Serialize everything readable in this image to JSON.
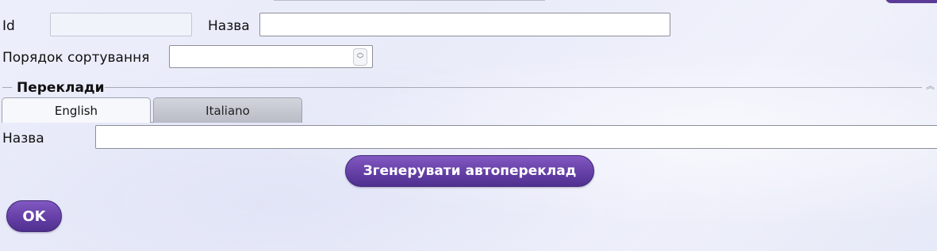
{
  "form": {
    "id_label": "Id",
    "id_value": "",
    "name_label": "Назва",
    "name_value": "",
    "sort_order_label": "Порядок сортування",
    "sort_order_value": ""
  },
  "translations": {
    "title": "Переклади",
    "tabs": [
      {
        "label": "English",
        "selected": true
      },
      {
        "label": "Italiano",
        "selected": false
      }
    ],
    "name_label": "Назва",
    "name_value": "",
    "autotranslate_button": "Згенерувати автопереклад"
  },
  "footer": {
    "ok_button": "OK"
  },
  "colors": {
    "accent": "#6a43ab",
    "background": "#eceefb"
  }
}
